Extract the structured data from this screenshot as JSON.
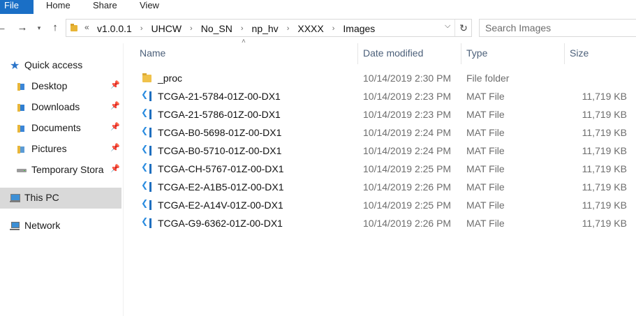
{
  "ribbon": {
    "tabs": [
      "File",
      "Home",
      "Share",
      "View"
    ]
  },
  "address_bar": {
    "overflow": "«",
    "path": [
      "v1.0.0.1",
      "UHCW",
      "No_SN",
      "np_hv",
      "XXXX",
      "Images"
    ]
  },
  "search": {
    "placeholder": "Search Images"
  },
  "nav_pane": {
    "items": [
      {
        "label": "Quick access",
        "icon": "star-icon"
      },
      {
        "label": "Desktop",
        "icon": "desktop-folder-icon",
        "pinned": true
      },
      {
        "label": "Downloads",
        "icon": "downloads-folder-icon",
        "pinned": true
      },
      {
        "label": "Documents",
        "icon": "documents-folder-icon",
        "pinned": true
      },
      {
        "label": "Pictures",
        "icon": "pictures-folder-icon",
        "pinned": true
      },
      {
        "label": "Temporary Stora",
        "icon": "drive-icon",
        "pinned": true
      },
      {
        "label": "This PC",
        "icon": "computer-icon",
        "selected": true
      },
      {
        "label": "Network",
        "icon": "network-icon"
      }
    ]
  },
  "columns": {
    "name": "Name",
    "date": "Date modified",
    "type": "Type",
    "size": "Size"
  },
  "files": [
    {
      "name": "_proc",
      "date": "10/14/2019 2:30 PM",
      "type": "File folder",
      "size": "",
      "icon": "folder-icon"
    },
    {
      "name": "TCGA-21-5784-01Z-00-DX1",
      "date": "10/14/2019 2:23 PM",
      "type": "MAT File",
      "size": "11,719 KB",
      "icon": "vscode-file-icon"
    },
    {
      "name": "TCGA-21-5786-01Z-00-DX1",
      "date": "10/14/2019 2:23 PM",
      "type": "MAT File",
      "size": "11,719 KB",
      "icon": "vscode-file-icon"
    },
    {
      "name": "TCGA-B0-5698-01Z-00-DX1",
      "date": "10/14/2019 2:24 PM",
      "type": "MAT File",
      "size": "11,719 KB",
      "icon": "vscode-file-icon"
    },
    {
      "name": "TCGA-B0-5710-01Z-00-DX1",
      "date": "10/14/2019 2:24 PM",
      "type": "MAT File",
      "size": "11,719 KB",
      "icon": "vscode-file-icon"
    },
    {
      "name": "TCGA-CH-5767-01Z-00-DX1",
      "date": "10/14/2019 2:25 PM",
      "type": "MAT File",
      "size": "11,719 KB",
      "icon": "vscode-file-icon"
    },
    {
      "name": "TCGA-E2-A1B5-01Z-00-DX1",
      "date": "10/14/2019 2:26 PM",
      "type": "MAT File",
      "size": "11,719 KB",
      "icon": "vscode-file-icon"
    },
    {
      "name": "TCGA-E2-A14V-01Z-00-DX1",
      "date": "10/14/2019 2:25 PM",
      "type": "MAT File",
      "size": "11,719 KB",
      "icon": "vscode-file-icon"
    },
    {
      "name": "TCGA-G9-6362-01Z-00-DX1",
      "date": "10/14/2019 2:26 PM",
      "type": "MAT File",
      "size": "11,719 KB",
      "icon": "vscode-file-icon"
    }
  ],
  "colors": {
    "file_tab": "#1a6fc6",
    "header_text": "#4c607a",
    "selected_nav": "#d9d9d9",
    "muted_text": "#6d6d6d"
  }
}
